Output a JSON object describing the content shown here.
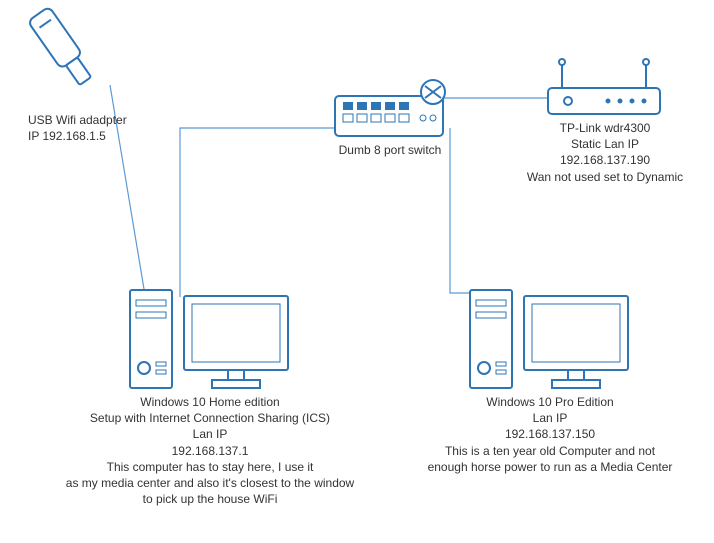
{
  "usb_wifi": {
    "line1": "USB Wifi adadpter",
    "line2": "IP 192.168.1.5"
  },
  "switch": {
    "label": "Dumb 8 port switch"
  },
  "router": {
    "line1": "TP-Link wdr4300",
    "line2": "Static Lan IP",
    "line3": "192.168.137.190",
    "line4": "Wan not used set to Dynamic"
  },
  "pc_left": {
    "line1": "Windows 10 Home edition",
    "line2": "Setup with Internet Connection Sharing (ICS)",
    "line3": "Lan IP",
    "line4": "192.168.137.1",
    "line5": "This computer has to stay here, I use it",
    "line6": "as my media center and also it's closest to the window",
    "line7": "to pick up the house WiFi"
  },
  "pc_right": {
    "line1": "Windows 10 Pro Edition",
    "line2": "Lan IP",
    "line3": "192.168.137.150",
    "line4": "This is a ten year old Computer and not",
    "line5": "enough horse power to run as a Media Center"
  },
  "chart_data": {
    "type": "table",
    "title": "Home network topology",
    "nodes": [
      {
        "id": "usb_wifi_adapter",
        "label": "USB Wifi adadpter",
        "ip": "192.168.1.5"
      },
      {
        "id": "switch",
        "label": "Dumb 8 port switch"
      },
      {
        "id": "router",
        "label": "TP-Link wdr4300",
        "lan_ip": "192.168.137.190",
        "lan_mode": "Static",
        "wan": "not used, set to Dynamic"
      },
      {
        "id": "pc_home",
        "label": "Windows 10 Home edition",
        "role": "Internet Connection Sharing (ICS)",
        "lan_ip": "192.168.137.1",
        "note": "media center, closest to window for house WiFi"
      },
      {
        "id": "pc_pro",
        "label": "Windows 10 Pro Edition",
        "lan_ip": "192.168.137.150",
        "note": "ten year old computer, not enough power for media center"
      }
    ],
    "edges": [
      [
        "usb_wifi_adapter",
        "pc_home"
      ],
      [
        "pc_home",
        "switch"
      ],
      [
        "switch",
        "router"
      ],
      [
        "switch",
        "pc_pro"
      ]
    ]
  }
}
